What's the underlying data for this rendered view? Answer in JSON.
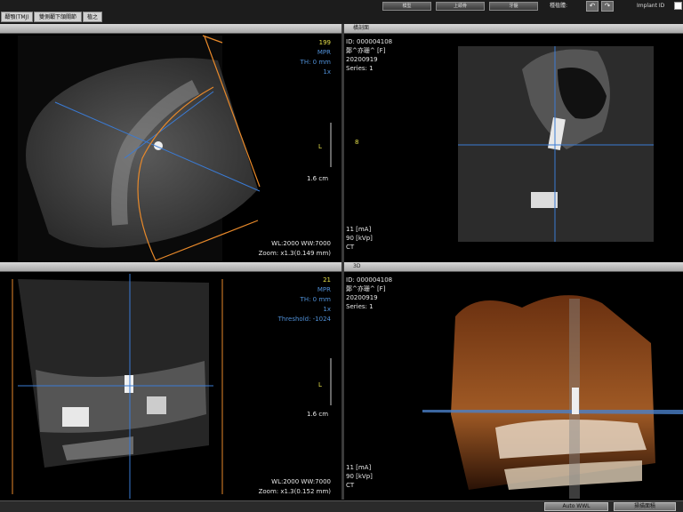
{
  "tabs": [
    {
      "label": "顳顎(TMJ)"
    },
    {
      "label": "雙側顳下頜關節"
    },
    {
      "label": "植之"
    }
  ],
  "toolbar": {
    "buttons": [
      {
        "label": "模型"
      },
      {
        "label": "上頜骨"
      },
      {
        "label": "牙髓"
      }
    ],
    "undo_redo_label": "種植體:",
    "undo_icon": "undo-icon",
    "redo_icon": "redo-icon",
    "implant_id_label": "Implant ID"
  },
  "viewports": {
    "axial": {
      "slice": "199",
      "mode": "MPR",
      "thickness": "TH: 0 mm",
      "zoom_factor": "1x",
      "ruler_label": "L",
      "scale": "1.6 cm",
      "window": "WL:2000 WW:7000",
      "zoom": "Zoom: x1.3(0.149 mm)"
    },
    "cross_section": {
      "title": "橫剖面",
      "patient_id": "ID: 000004108",
      "patient_name": "鄭^亦珊^ [F]",
      "date": "20200919",
      "series": "Series: 1",
      "marker": "8",
      "ma": "11 [mA]",
      "kvp": "90 [kVp]",
      "modality": "CT"
    },
    "panoramic": {
      "slice": "21",
      "mode": "MPR",
      "thickness": "TH: 0 mm",
      "zoom_factor": "1x",
      "threshold": "Threshold: -1024",
      "ruler_label": "L",
      "scale": "1.6 cm",
      "window": "WL:2000 WW:7000",
      "zoom": "Zoom: x1.3(0.152 mm)"
    },
    "volume": {
      "title": "3D",
      "patient_id": "ID: 000004108",
      "patient_name": "鄭^亦珊^ [F]",
      "date": "20200919",
      "series": "Series: 1",
      "ma": "11 [mA]",
      "kvp": "90 [kVp]",
      "modality": "CT"
    }
  },
  "statusbar": {
    "auto_wwl": "Auto WWL",
    "right_button": "掃描面積"
  },
  "colors": {
    "crosshair": "#3a7bd5",
    "guide_orange": "#e8892a",
    "overlay_yellow": "#e6e04a",
    "overlay_blue": "#4f8fd6"
  }
}
